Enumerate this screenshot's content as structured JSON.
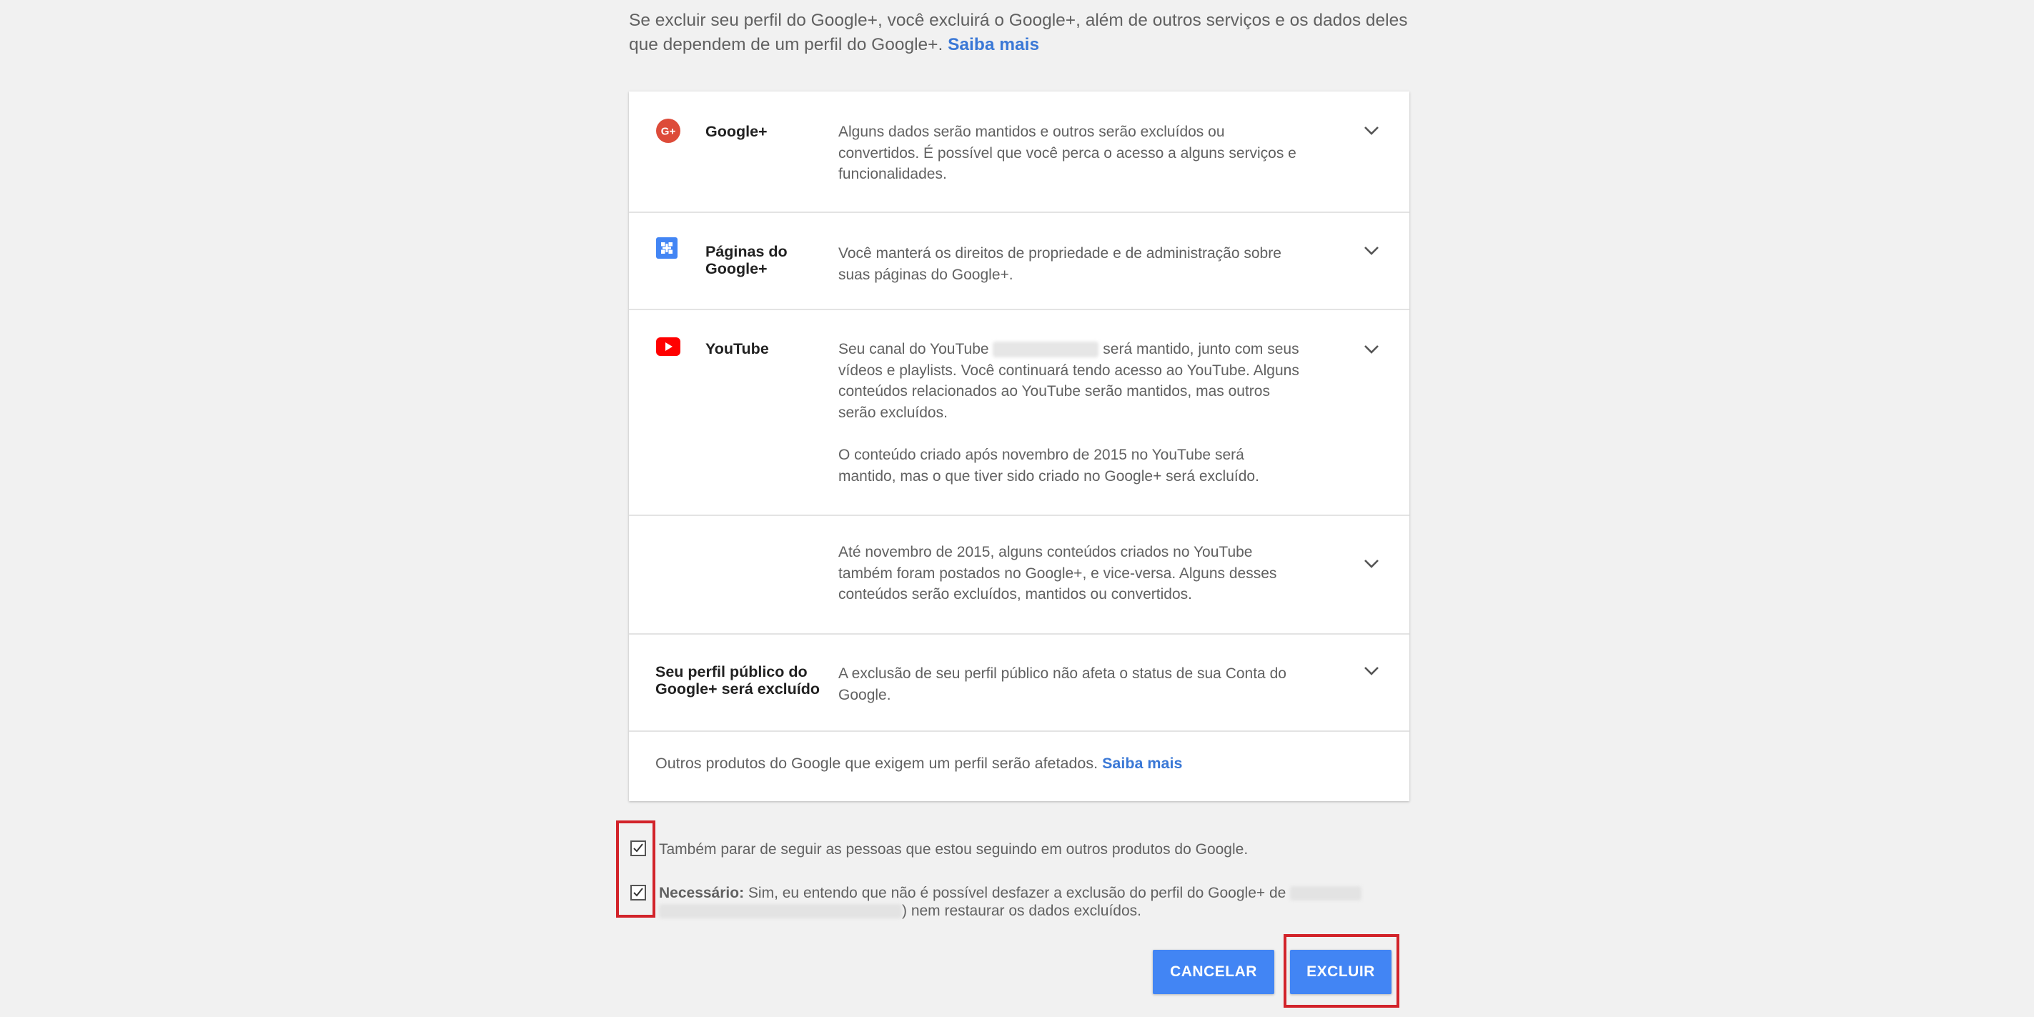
{
  "intro": {
    "text": "Se excluir seu perfil do Google+, você excluirá o Google+, além de outros serviços e os dados deles que dependem de um perfil do Google+.",
    "link": "Saiba mais"
  },
  "services": [
    {
      "title": "Google+",
      "icon": "google-plus-icon",
      "description": "Alguns dados serão mantidos e outros serão excluídos ou convertidos. É possível que você perca o acesso a alguns serviços e funcionalidades."
    },
    {
      "title": "Páginas do Google+",
      "icon": "google-pages-icon",
      "description": "Você manterá os direitos de propriedade e de administração sobre suas páginas do Google+."
    },
    {
      "title": "YouTube",
      "icon": "youtube-icon",
      "description_pre": "Seu canal do YouTube",
      "description_post": "será mantido, junto com seus vídeos e playlists. Você continuará tendo acesso ao YouTube. Alguns conteúdos relacionados ao YouTube serão mantidos, mas outros serão excluídos.",
      "description_2": "O conteúdo criado após novembro de 2015 no YouTube será mantido, mas o que tiver sido criado no Google+ será excluído."
    },
    {
      "title": "",
      "description": "Até novembro de 2015, alguns conteúdos criados no YouTube também foram postados no Google+, e vice-versa. Alguns desses conteúdos serão excluídos, mantidos ou convertidos."
    },
    {
      "title": "Seu perfil público do Google+ será excluído",
      "description": "A exclusão de seu perfil público não afeta o status de sua Conta do Google."
    }
  ],
  "footer_note": {
    "text": "Outros produtos do Google que exigem um perfil serão afetados.",
    "link": "Saiba mais"
  },
  "checkboxes": {
    "unfollow": {
      "checked": true,
      "label": "Também parar de seguir as pessoas que estou seguindo em outros produtos do Google."
    },
    "confirm": {
      "checked": true,
      "bold": "Necessário:",
      "label_pre": "Sim, eu entendo que não é possível desfazer a exclusão do perfil do Google+ de",
      "label_post": ") nem restaurar os dados excluídos."
    }
  },
  "buttons": {
    "cancel": "CANCELAR",
    "delete": "EXCLUIR"
  },
  "colors": {
    "accent": "#4285f4",
    "link": "#3a78d6",
    "highlight": "#d2232a",
    "google_plus_red": "#dd4b39",
    "youtube_red": "#ff0000"
  }
}
